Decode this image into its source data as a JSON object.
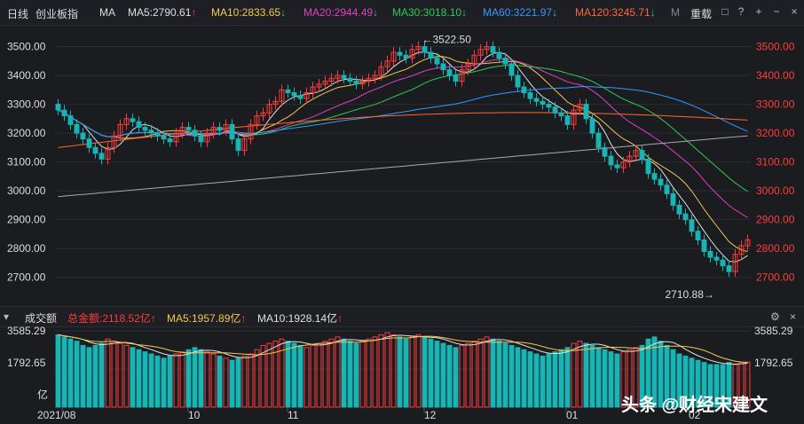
{
  "header": {
    "period": "日线",
    "index_name": "创业板指",
    "ma_mode": "MA",
    "ma_items": [
      {
        "label": "MA5:2790.61",
        "dir": "up",
        "color": "#e0e0e0"
      },
      {
        "label": "MA10:2833.65",
        "dir": "down",
        "color": "#f2c94c"
      },
      {
        "label": "MA20:2944.49",
        "dir": "down",
        "color": "#e040c0"
      },
      {
        "label": "MA30:3018.10",
        "dir": "down",
        "color": "#2ecc55"
      },
      {
        "label": "MA60:3221.97",
        "dir": "down",
        "color": "#3399ff"
      },
      {
        "label": "MA120:3245.71",
        "dir": "down",
        "color": "#ff6633"
      },
      {
        "label": "M",
        "dir": "",
        "color": "#888888"
      }
    ],
    "adjust": "重载",
    "arrows": {
      "up": "↑",
      "down": "↓"
    }
  },
  "price_axis": {
    "ticks": [
      "3500.00",
      "3400.00",
      "3300.00",
      "3200.00",
      "3100.00",
      "3000.00",
      "2900.00",
      "2800.00",
      "2700.00"
    ]
  },
  "annotations": {
    "high": "←3522.50",
    "low": "2710.88→"
  },
  "volume": {
    "title": "成交额",
    "total": "总金额:2118.52亿",
    "ma5": "MA5:1957.89亿",
    "ma10": "MA10:1928.14亿",
    "ticks": [
      "3585.29",
      "1792.65"
    ],
    "unit": "亿"
  },
  "x_axis": {
    "labels": [
      "2021/08",
      "10",
      "11",
      "12",
      "01",
      "02"
    ]
  },
  "watermark": "头条 @财经宋建文",
  "colors": {
    "up": "#ff3b3b",
    "down": "#19b4b4",
    "ma5": "#e0e0e0",
    "ma10": "#f2c94c",
    "ma20": "#e040c0",
    "ma30": "#2ecc55",
    "ma60": "#3399ff",
    "ma120": "#ff6633",
    "ma250": "#aaaaaa"
  },
  "chart_data": {
    "type": "candlestick",
    "price_range": [
      2650,
      3560
    ],
    "closes": [
      3280,
      3260,
      3230,
      3200,
      3180,
      3150,
      3130,
      3110,
      3150,
      3190,
      3230,
      3250,
      3240,
      3220,
      3210,
      3200,
      3190,
      3180,
      3170,
      3200,
      3220,
      3210,
      3190,
      3170,
      3200,
      3220,
      3210,
      3230,
      3180,
      3140,
      3180,
      3230,
      3260,
      3270,
      3300,
      3310,
      3350,
      3340,
      3330,
      3320,
      3340,
      3360,
      3370,
      3380,
      3390,
      3400,
      3390,
      3380,
      3370,
      3380,
      3390,
      3400,
      3430,
      3450,
      3480,
      3470,
      3460,
      3490,
      3500,
      3480,
      3460,
      3440,
      3420,
      3400,
      3380,
      3420,
      3440,
      3470,
      3490,
      3500,
      3480,
      3460,
      3440,
      3400,
      3360,
      3340,
      3320,
      3310,
      3300,
      3290,
      3270,
      3260,
      3230,
      3280,
      3300,
      3250,
      3200,
      3150,
      3120,
      3090,
      3080,
      3100,
      3120,
      3140,
      3110,
      3060,
      3040,
      3020,
      2990,
      2950,
      2920,
      2900,
      2860,
      2830,
      2790,
      2770,
      2760,
      2740,
      2720,
      2780,
      2810,
      2830
    ],
    "volume_max": 3585.29,
    "volume_mid": 1792.65,
    "volumes": [
      3400,
      3300,
      3200,
      3100,
      2900,
      2800,
      2900,
      3000,
      3200,
      3100,
      3000,
      2900,
      2800,
      2700,
      2600,
      2500,
      2400,
      2300,
      2400,
      2500,
      2600,
      2700,
      2800,
      2700,
      2600,
      2500,
      2400,
      2300,
      2200,
      2300,
      2400,
      2500,
      2700,
      2900,
      3000,
      3100,
      3200,
      3100,
      3000,
      2900,
      2800,
      2900,
      3000,
      3100,
      3200,
      3300,
      3200,
      3100,
      3000,
      3100,
      3200,
      3300,
      3400,
      3500,
      3400,
      3300,
      3200,
      3300,
      3400,
      3300,
      3200,
      3100,
      3000,
      2900,
      2800,
      2900,
      3000,
      3100,
      3200,
      3300,
      3200,
      3100,
      3000,
      2900,
      2800,
      2700,
      2600,
      2500,
      2400,
      2500,
      2600,
      2700,
      2800,
      3000,
      3100,
      3000,
      2900,
      2800,
      2700,
      2600,
      2500,
      2600,
      2700,
      2800,
      2900,
      3200,
      3300,
      3100,
      2900,
      2700,
      2500,
      2400,
      2300,
      2200,
      2100,
      2000,
      2000,
      2000,
      2100,
      2000,
      2100,
      2118
    ]
  }
}
